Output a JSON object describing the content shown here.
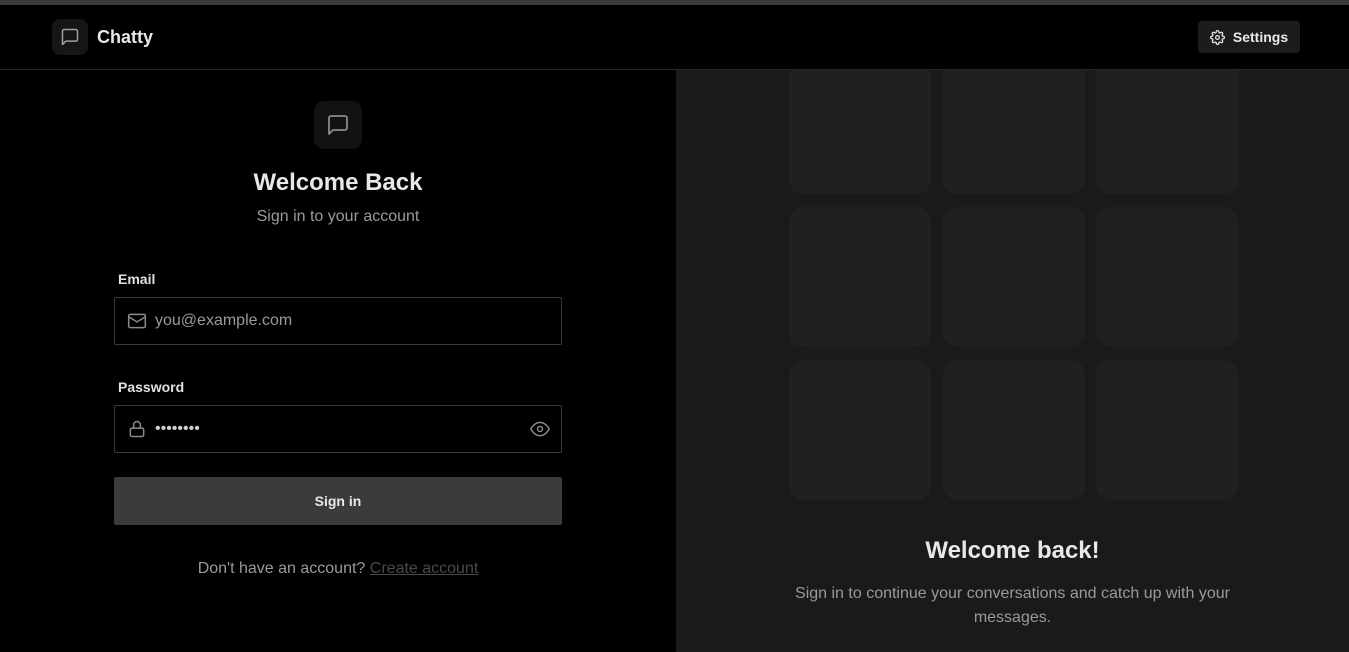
{
  "header": {
    "brand_name": "Chatty",
    "brand_icon": "message-square-icon",
    "settings_label": "Settings",
    "settings_icon": "gear-icon"
  },
  "login": {
    "hero_icon": "message-square-icon",
    "title": "Welcome Back",
    "subtitle": "Sign in to your account",
    "email_label": "Email",
    "email_placeholder": "you@example.com",
    "email_value": "",
    "password_label": "Password",
    "password_value": "••••••••",
    "submit_label": "Sign in",
    "signup_prompt": "Don't have an account?",
    "signup_link": "Create account"
  },
  "side": {
    "title": "Welcome back!",
    "text": "Sign in to continue your conversations and catch up with your messages.",
    "tile_count": 9
  },
  "colors": {
    "background": "#000000",
    "panel": "#191a1a",
    "tile": "#1f2020",
    "button": "#3b3b3b",
    "muted_text": "#9a9a9a"
  }
}
